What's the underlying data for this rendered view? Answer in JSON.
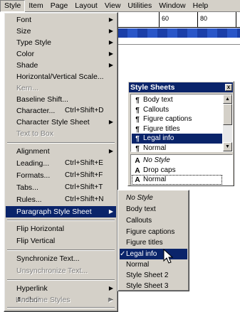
{
  "menubar": {
    "items": [
      "Style",
      "Item",
      "Page",
      "Layout",
      "View",
      "Utilities",
      "Window",
      "Help"
    ],
    "active_index": 0
  },
  "ruler": {
    "labels": [
      "60",
      "80"
    ]
  },
  "style_menu": {
    "items": [
      {
        "label": "Font",
        "submenu": true,
        "disabled": false
      },
      {
        "label": "Size",
        "submenu": true,
        "disabled": false
      },
      {
        "label": "Type Style",
        "submenu": true,
        "disabled": false
      },
      {
        "label": "Color",
        "submenu": true,
        "disabled": false
      },
      {
        "label": "Shade",
        "submenu": true,
        "disabled": false
      },
      {
        "label": "Horizontal/Vertical Scale...",
        "submenu": false,
        "disabled": false
      },
      {
        "label": "Kern...",
        "submenu": false,
        "disabled": true
      },
      {
        "label": "Baseline Shift...",
        "submenu": false,
        "disabled": false
      },
      {
        "label": "Character...",
        "shortcut": "Ctrl+Shift+D",
        "submenu": false,
        "disabled": false
      },
      {
        "label": "Character Style Sheet",
        "submenu": true,
        "disabled": false
      },
      {
        "label": "Text to Box",
        "submenu": false,
        "disabled": true
      },
      {
        "label": "Alignment",
        "submenu": true,
        "disabled": false
      },
      {
        "label": "Leading...",
        "shortcut": "Ctrl+Shift+E",
        "submenu": false,
        "disabled": false
      },
      {
        "label": "Formats...",
        "shortcut": "Ctrl+Shift+F",
        "submenu": false,
        "disabled": false
      },
      {
        "label": "Tabs...",
        "shortcut": "Ctrl+Shift+T",
        "submenu": false,
        "disabled": false
      },
      {
        "label": "Rules...",
        "shortcut": "Ctrl+Shift+N",
        "submenu": false,
        "disabled": false
      },
      {
        "label": "Paragraph Style Sheet",
        "submenu": true,
        "disabled": false,
        "selected": true
      },
      {
        "label": "Flip Horizontal",
        "submenu": false,
        "disabled": false
      },
      {
        "label": "Flip Vertical",
        "submenu": false,
        "disabled": false
      },
      {
        "label": "Synchronize Text...",
        "submenu": false,
        "disabled": false
      },
      {
        "label": "Unsynchronize Text...",
        "submenu": false,
        "disabled": true
      },
      {
        "label": "Hyperlink",
        "submenu": true,
        "disabled": false
      },
      {
        "label": "Anchor",
        "submenu": true,
        "disabled": false
      },
      {
        "label": "Underline Styles",
        "submenu": true,
        "disabled": true
      }
    ]
  },
  "paragraph_submenu": {
    "items": [
      {
        "label": "No Style",
        "italic": true
      },
      {
        "label": "Body text"
      },
      {
        "label": "Callouts"
      },
      {
        "label": "Figure captions"
      },
      {
        "label": "Figure titles"
      },
      {
        "label": "Legal info",
        "checked": true,
        "selected": true
      },
      {
        "label": "Normal"
      },
      {
        "label": "Style Sheet 2"
      },
      {
        "label": "Style Sheet 3"
      }
    ]
  },
  "style_sheets_palette": {
    "title": "Style Sheets",
    "close_glyph": "x",
    "paragraph_items": [
      {
        "label": "Body text"
      },
      {
        "label": "Callouts"
      },
      {
        "label": "Figure captions"
      },
      {
        "label": "Figure titles"
      },
      {
        "label": "Legal info",
        "selected": true
      },
      {
        "label": "Normal"
      }
    ],
    "character_items": [
      {
        "label": "No Style",
        "italic": true
      },
      {
        "label": "Drop caps"
      },
      {
        "label": "Normal",
        "dotted": true
      }
    ],
    "paragraph_glyph": "¶",
    "character_glyph": "A"
  },
  "colors": {
    "menu_bg": "#d4d0c8",
    "highlight": "#0a246a"
  }
}
